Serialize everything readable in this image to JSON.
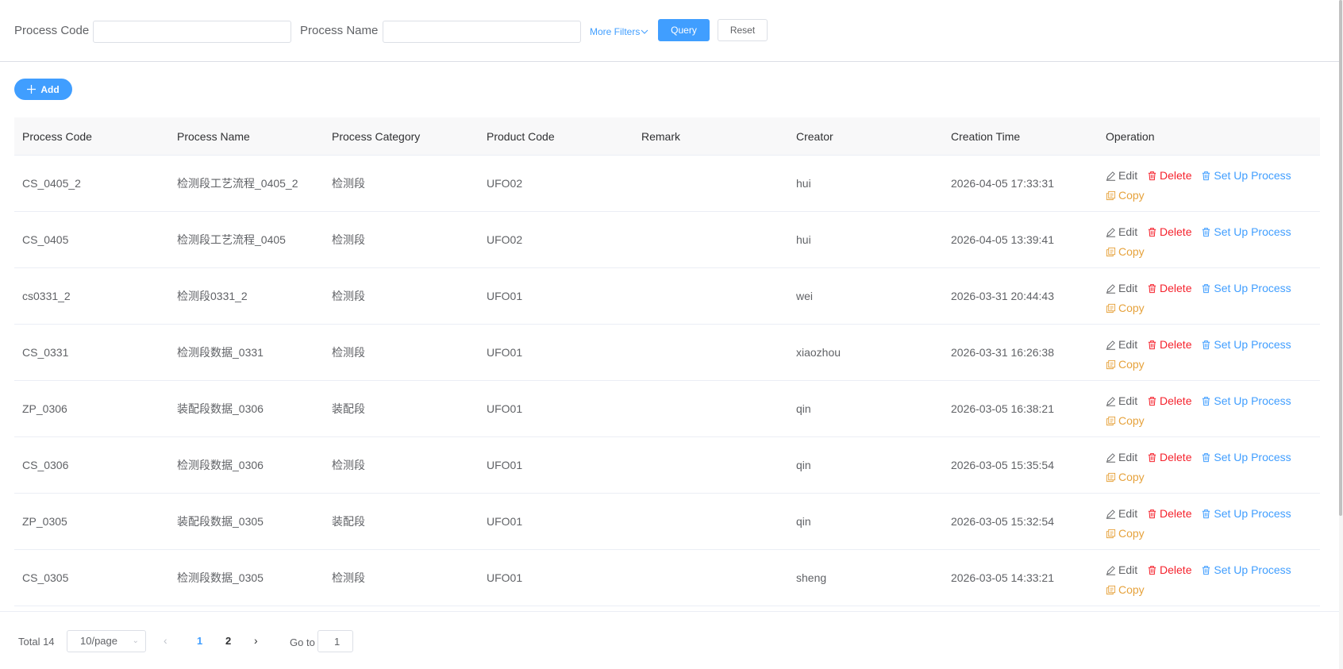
{
  "filters": {
    "process_code_label": "Process Code",
    "process_code_value": "",
    "process_name_label": "Process Name",
    "process_name_value": "",
    "more_filters": "More Filters",
    "query": "Query",
    "reset": "Reset"
  },
  "toolbar": {
    "add_label": "Add"
  },
  "table": {
    "headers": [
      "Process Code",
      "Process Name",
      "Process Category",
      "Product Code",
      "Remark",
      "Creator",
      "Creation Time",
      "Operation"
    ],
    "ops": {
      "edit": "Edit",
      "delete": "Delete",
      "setup": "Set Up Process",
      "copy": "Copy"
    },
    "rows": [
      {
        "code": "CS_0405_2",
        "name": "检测段工艺流程_0405_2",
        "category": "检测段",
        "product": "UFO02",
        "remark": "",
        "creator": "hui",
        "time": "2026-04-05 17:33:31"
      },
      {
        "code": "CS_0405",
        "name": "检测段工艺流程_0405",
        "category": "检测段",
        "product": "UFO02",
        "remark": "",
        "creator": "hui",
        "time": "2026-04-05 13:39:41"
      },
      {
        "code": "cs0331_2",
        "name": "检测段0331_2",
        "category": "检测段",
        "product": "UFO01",
        "remark": "",
        "creator": "wei",
        "time": "2026-03-31 20:44:43"
      },
      {
        "code": "CS_0331",
        "name": "检测段数据_0331",
        "category": "检测段",
        "product": "UFO01",
        "remark": "",
        "creator": "xiaozhou",
        "time": "2026-03-31 16:26:38"
      },
      {
        "code": "ZP_0306",
        "name": "装配段数据_0306",
        "category": "装配段",
        "product": "UFO01",
        "remark": "",
        "creator": "qin",
        "time": "2026-03-05 16:38:21"
      },
      {
        "code": "CS_0306",
        "name": "检测段数据_0306",
        "category": "检测段",
        "product": "UFO01",
        "remark": "",
        "creator": "qin",
        "time": "2026-03-05 15:35:54"
      },
      {
        "code": "ZP_0305",
        "name": "装配段数据_0305",
        "category": "装配段",
        "product": "UFO01",
        "remark": "",
        "creator": "qin",
        "time": "2026-03-05 15:32:54"
      },
      {
        "code": "CS_0305",
        "name": "检测段数据_0305",
        "category": "检测段",
        "product": "UFO01",
        "remark": "",
        "creator": "sheng",
        "time": "2026-03-05 14:33:21"
      }
    ]
  },
  "pagination": {
    "total": "Total 14",
    "page_size": "10/page",
    "pages": [
      "1",
      "2"
    ],
    "current_page": "1",
    "goto_label": "Go to",
    "goto_value": "1"
  },
  "colors": {
    "primary": "#409eff",
    "danger": "#f5222d",
    "warning": "#e6a23c"
  }
}
